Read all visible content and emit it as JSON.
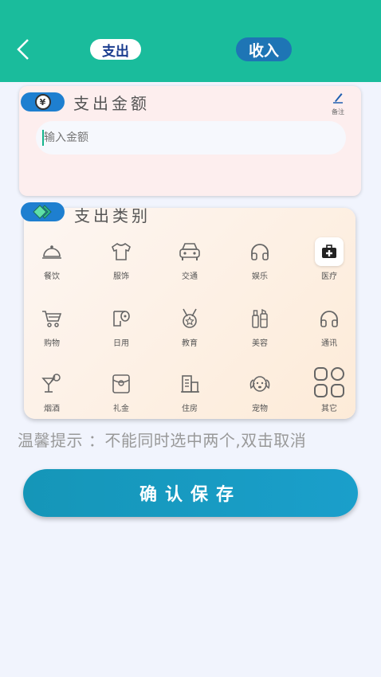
{
  "header": {
    "tab_expense": "支出",
    "tab_income": "收入"
  },
  "amount": {
    "title": "支出金额",
    "note_label": "备注",
    "placeholder": "输入金额",
    "currency_symbol": "¥"
  },
  "category": {
    "title": "支出类别",
    "items": [
      {
        "label": "餐饮",
        "icon": "cloche-icon"
      },
      {
        "label": "服饰",
        "icon": "shirt-icon"
      },
      {
        "label": "交通",
        "icon": "car-icon"
      },
      {
        "label": "娱乐",
        "icon": "headphones-icon"
      },
      {
        "label": "医疗",
        "icon": "medical-kit-icon"
      },
      {
        "label": "购物",
        "icon": "cart-icon"
      },
      {
        "label": "日用",
        "icon": "toilet-paper-icon"
      },
      {
        "label": "教育",
        "icon": "medal-icon"
      },
      {
        "label": "美容",
        "icon": "cosmetics-icon"
      },
      {
        "label": "通讯",
        "icon": "headphones-icon"
      },
      {
        "label": "烟酒",
        "icon": "cocktail-icon"
      },
      {
        "label": "礼金",
        "icon": "gift-icon"
      },
      {
        "label": "住房",
        "icon": "building-icon"
      },
      {
        "label": "宠物",
        "icon": "dog-icon"
      },
      {
        "label": "其它",
        "icon": "grid-icon"
      }
    ]
  },
  "tip": "温馨提示 ：不能同时选中两个,双击取消",
  "save_label": "确认保存",
  "colors": {
    "header": "#1abc9c",
    "accent": "#1e7fd0",
    "save": "#1596b8"
  }
}
